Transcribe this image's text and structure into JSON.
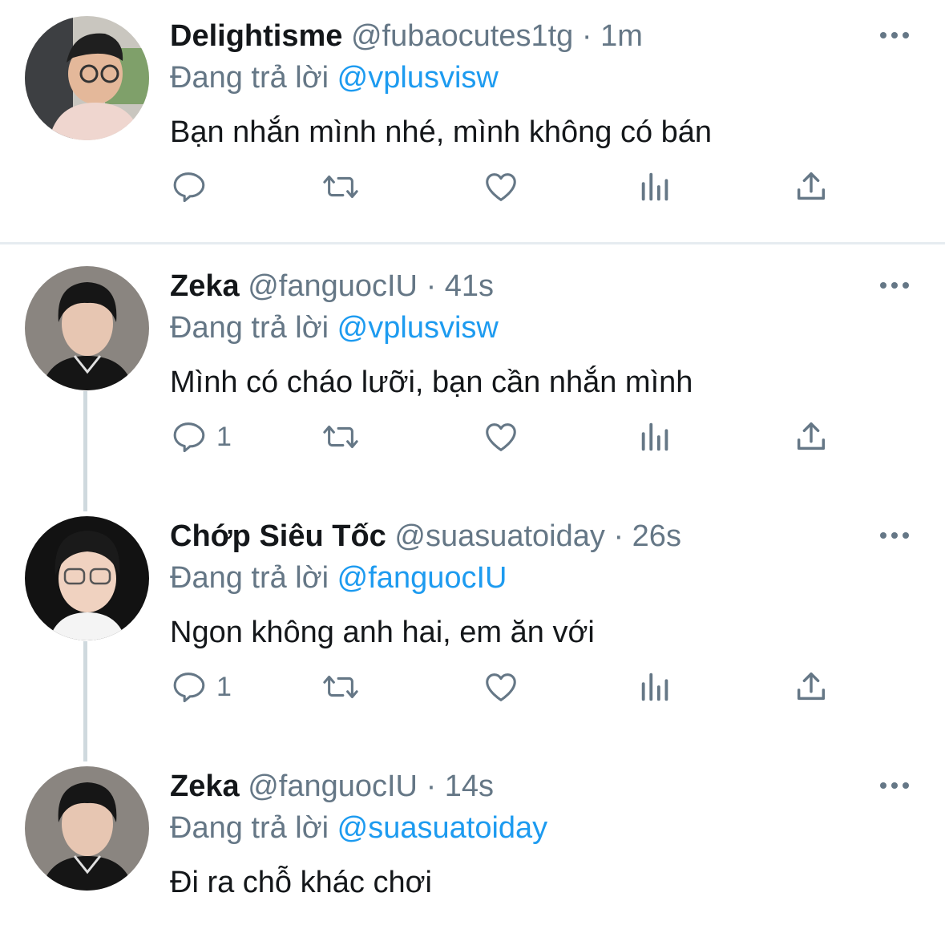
{
  "colors": {
    "link": "#1d9bf0",
    "muted": "#657786",
    "text": "#14171a",
    "thread": "#cfd9de"
  },
  "tweets": [
    {
      "name": "Delightisme",
      "handle": "@fubaocutes1tg",
      "dot": "·",
      "time": "1m",
      "reply_prefix": "Đang trả lời",
      "reply_to": "@vplusvisw",
      "text": "Bạn nhắn mình nhé, mình không có bán",
      "reply_count": ""
    },
    {
      "name": "Zeka",
      "handle": "@fanguocIU",
      "dot": "·",
      "time": "41s",
      "reply_prefix": "Đang trả lời",
      "reply_to": "@vplusvisw",
      "text": "Mình có cháo lưỡi, bạn cần nhắn mình",
      "reply_count": "1"
    },
    {
      "name": "Chớp Siêu Tốc",
      "handle": "@suasuatoiday",
      "dot": "·",
      "time": "26s",
      "reply_prefix": "Đang trả lời",
      "reply_to": "@fanguocIU",
      "text": "Ngon không anh hai, em ăn với",
      "reply_count": "1"
    },
    {
      "name": "Zeka",
      "handle": "@fanguocIU",
      "dot": "·",
      "time": "14s",
      "reply_prefix": "Đang trả lời",
      "reply_to": "@suasuatoiday",
      "text": "Đi ra chỗ khác chơi",
      "reply_count": ""
    }
  ],
  "icons": {
    "reply": "reply-bubble-icon",
    "retweet": "retweet-icon",
    "like": "heart-icon",
    "views": "views-bar-chart-icon",
    "share": "share-upload-icon",
    "more": "more-dots-icon"
  }
}
